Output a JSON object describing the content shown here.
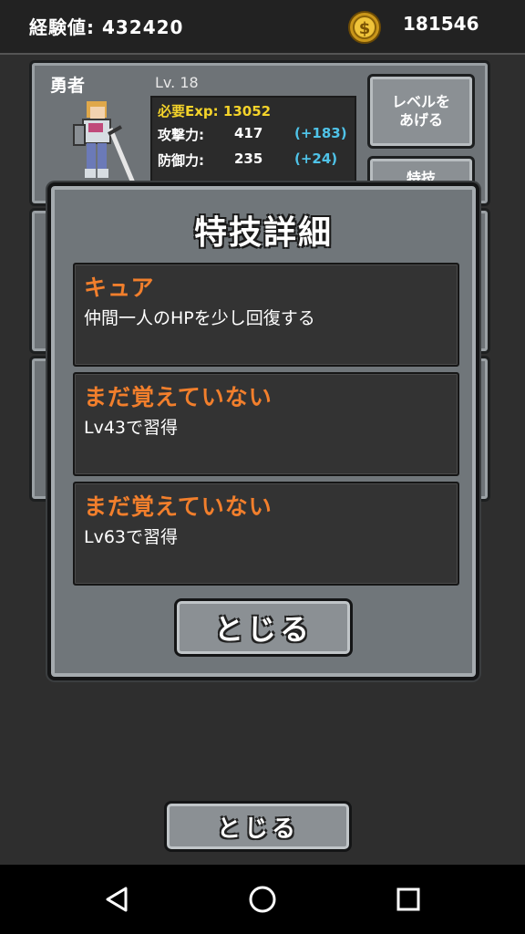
{
  "topbar": {
    "exp_text": "経験値: 432420",
    "coin_icon": "gold-coin-icon",
    "coin_count": "181546"
  },
  "hero": {
    "name": "勇者",
    "level": "Lv. 18",
    "required_exp": "必要Exp: 13052",
    "stats": [
      {
        "label": "攻撃力:",
        "value": "417",
        "bonus": "(+183)"
      },
      {
        "label": "防御力:",
        "value": "235",
        "bonus": "(+24)"
      }
    ],
    "levelup_button": "レベルを\nあげる",
    "skill_button": "特技"
  },
  "modal": {
    "title": "特技詳細",
    "skills": [
      {
        "name": "キュア",
        "description": "仲間一人のHPを少し回復する"
      },
      {
        "name": "まだ覚えていない",
        "description": "Lv43で習得"
      },
      {
        "name": "まだ覚えていない",
        "description": "Lv63で習得"
      }
    ],
    "close_label": "とじる"
  },
  "footer": {
    "close_label": "とじる"
  },
  "navbar": {
    "back_icon": "back-triangle-icon",
    "home_icon": "home-circle-icon",
    "recents_icon": "recents-square-icon"
  },
  "colors": {
    "skill_name": "#f27f2c",
    "required_exp": "#f4d32a",
    "bonus": "#4fc3e8",
    "stone": "#70767a"
  }
}
